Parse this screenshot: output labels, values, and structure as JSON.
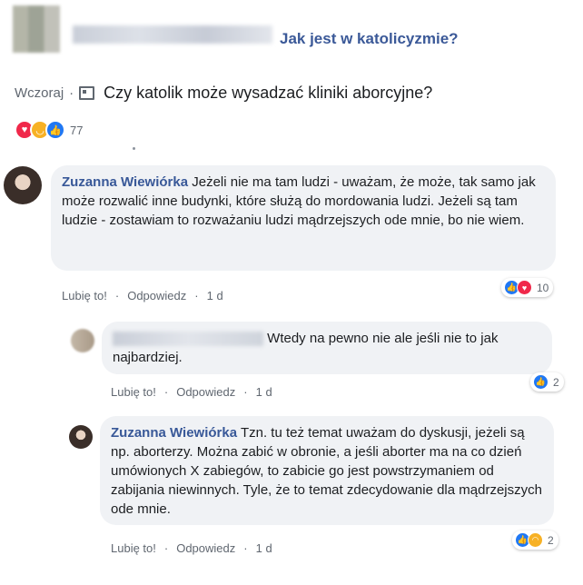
{
  "post": {
    "title": "Jak jest w katolicyzmie?",
    "time": "Wczoraj",
    "separator": "·",
    "question": "Czy katolik może wysadzać kliniki aborcyjne?",
    "reaction_count": "77"
  },
  "comments": [
    {
      "author": "Zuzanna Wiewiórka",
      "text": "Jeżeli nie ma tam ludzi - uważam, że może, tak samo jak może rozwalić inne budynki, które służą do mordowania ludzi. Jeżeli są tam ludzie - zostawiam to rozważaniu ludzi mądrzejszych ode mnie, bo nie wiem.",
      "like": "Lubię to!",
      "reply": "Odpowiedz",
      "time": "1 d",
      "reaction_count": "10"
    },
    {
      "author": "",
      "text": "Wtedy na pewno nie ale jeśli nie to jak najbardziej.",
      "like": "Lubię to!",
      "reply": "Odpowiedz",
      "time": "1 d",
      "reaction_count": "2"
    },
    {
      "author": "Zuzanna Wiewiórka",
      "text": "Tzn. tu też temat uważam do dyskusji, jeżeli są np. aborterzy. Można zabić w obronie, a jeśli aborter ma na co dzień umówionych X zabiegów, to zabicie go jest powstrzymaniem od zabijania niewinnych. Tyle, że to temat zdecydowanie dla mądrzejszych ode mnie.",
      "like": "Lubię to!",
      "reply": "Odpowiedz",
      "time": "1 d",
      "reaction_count": "2"
    }
  ],
  "icons": {
    "love": "love-reaction-icon",
    "haha": "haha-reaction-icon",
    "like": "like-reaction-icon",
    "news": "news-icon"
  },
  "colors": {
    "link": "#385898",
    "title": "#3b5998",
    "bubble": "#f0f2f5",
    "love": "#f0284a",
    "haha": "#f7b125",
    "like": "#2078f4"
  }
}
